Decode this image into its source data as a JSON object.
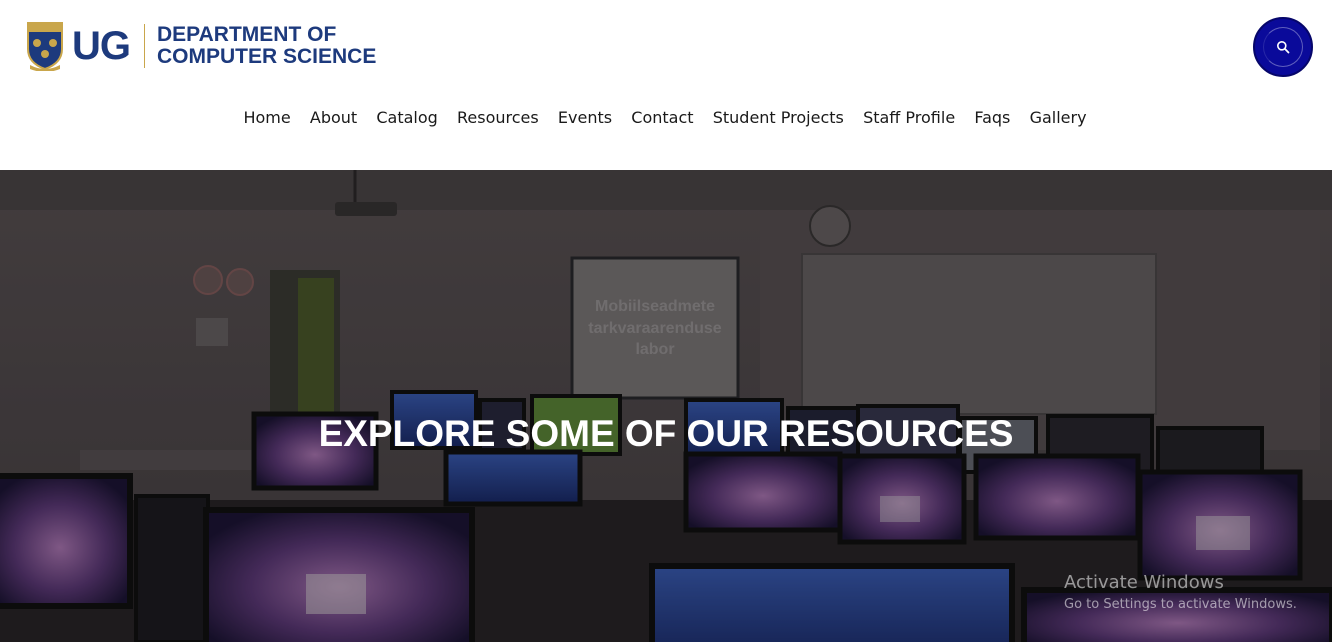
{
  "header": {
    "logo_abbr": "UG",
    "dept_line1": "DEPARTMENT OF",
    "dept_line2": "COMPUTER SCIENCE",
    "search_icon": "search-icon"
  },
  "nav": {
    "items": [
      {
        "label": "Home"
      },
      {
        "label": "About"
      },
      {
        "label": "Catalog"
      },
      {
        "label": "Resources"
      },
      {
        "label": "Events"
      },
      {
        "label": "Contact"
      },
      {
        "label": "Student Projects"
      },
      {
        "label": "Staff Profile"
      },
      {
        "label": "Faqs"
      },
      {
        "label": "Gallery"
      }
    ]
  },
  "hero": {
    "title": "EXPLORE SOME OF OUR RESOURCES",
    "whiteboard_text": [
      "Mobiilseadmete",
      "tarkvaraarenduse",
      "labor"
    ]
  },
  "watermark": {
    "title": "Activate Windows",
    "subtitle": "Go to Settings to activate Windows."
  },
  "colors": {
    "brand_blue": "#1d3a7d",
    "search_button": "#0a0a9a",
    "nav_text": "#1a1a1a",
    "hero_title": "#ffffff"
  }
}
